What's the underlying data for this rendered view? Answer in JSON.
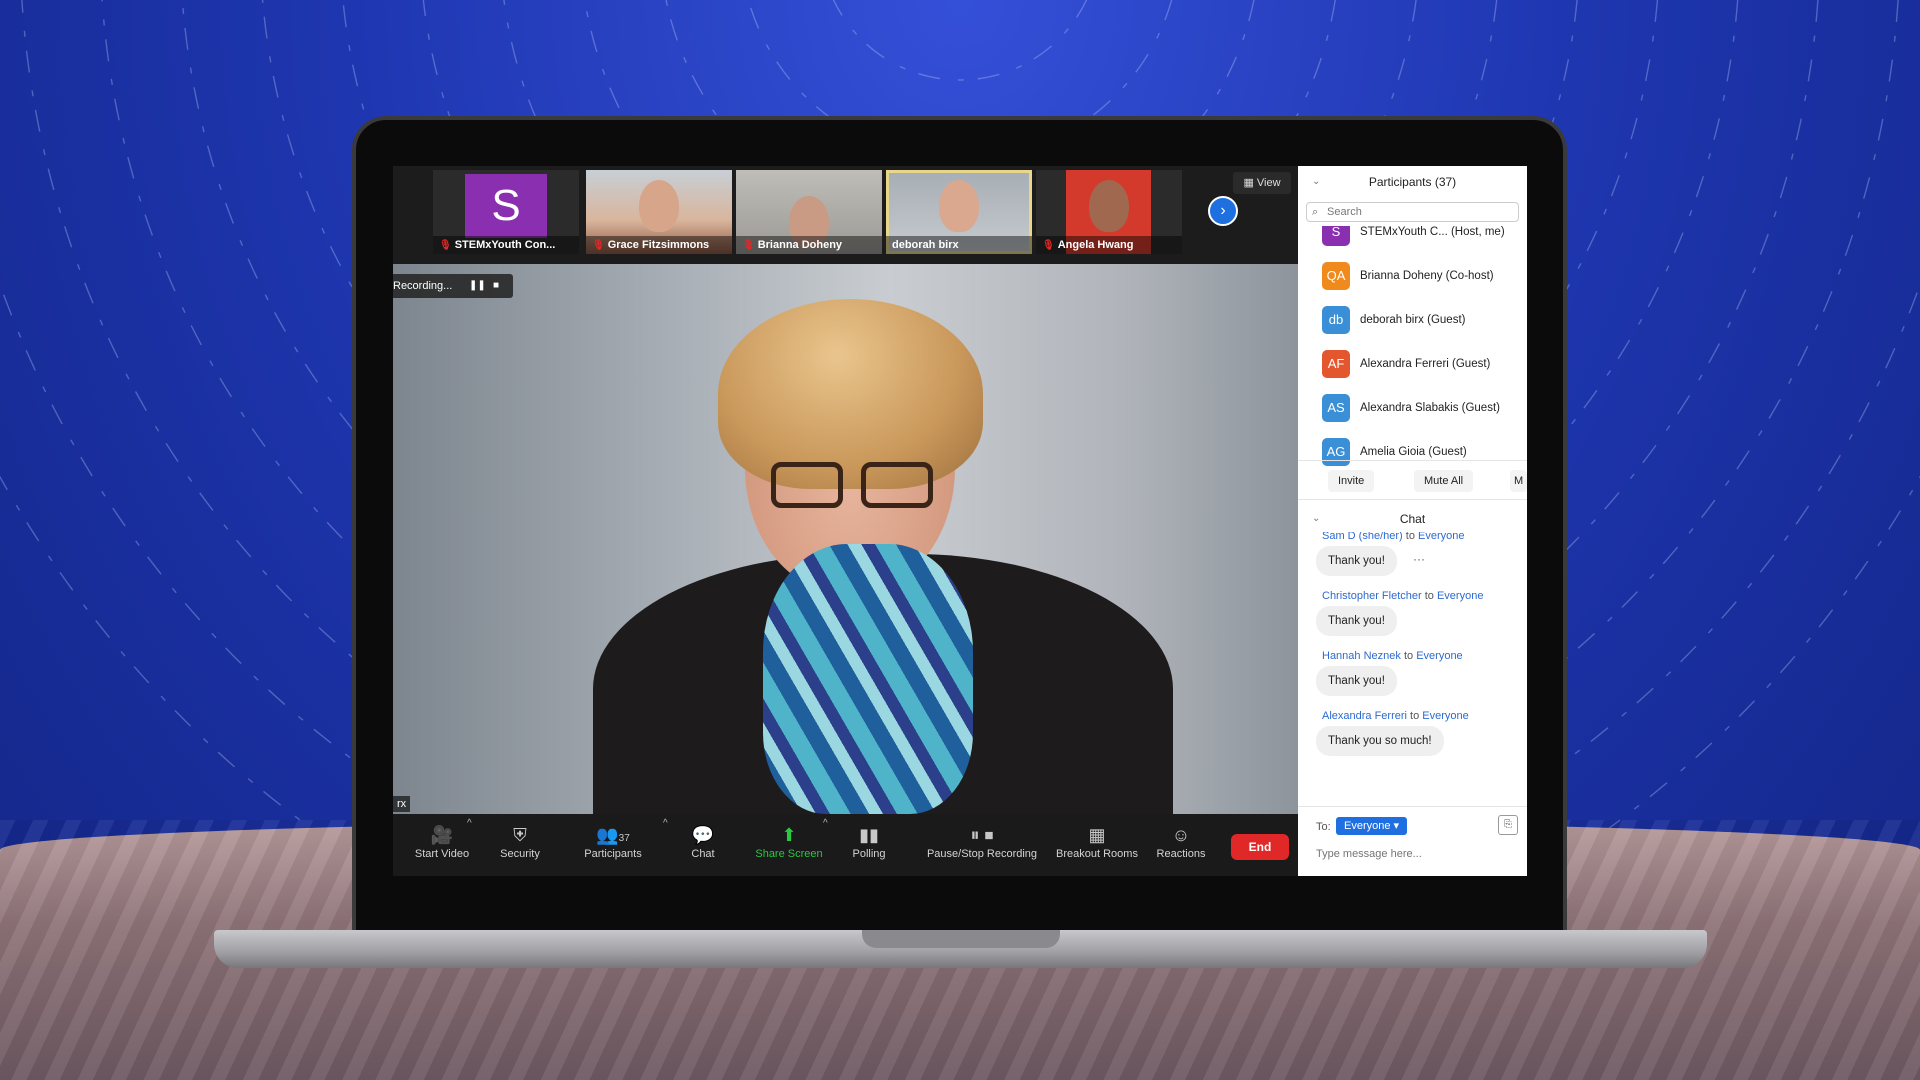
{
  "colors": {
    "accent": "#1f6fe0",
    "end_button": "#e02828",
    "share_screen": "#28c840",
    "chat_name": "#2d6ad0",
    "active_speaker_border": "#e8d78a"
  },
  "gallery": {
    "view_label": "View",
    "tiles": [
      {
        "name": "STEMxYouth Con...",
        "avatar_letter": "S",
        "avatar_color": "#8a2fb0",
        "muted": true
      },
      {
        "name": "Grace Fitzsimmons",
        "muted": true
      },
      {
        "name": "Brianna Doheny",
        "muted": true
      },
      {
        "name": "deborah birx",
        "muted": false,
        "active": true
      },
      {
        "name": "Angela Hwang",
        "muted": true
      }
    ],
    "next_icon": "chevron-right-icon"
  },
  "main_video": {
    "recording_label": "Recording...",
    "pause_icon": "pause-icon",
    "stop_icon": "stop-icon",
    "name_tag": "rx"
  },
  "toolbar": {
    "start_video": "Start Video",
    "security": "Security",
    "participants": "Participants",
    "participants_count": "37",
    "chat": "Chat",
    "share_screen": "Share Screen",
    "polling": "Polling",
    "pause_stop_recording": "Pause/Stop Recording",
    "breakout_rooms": "Breakout Rooms",
    "reactions": "Reactions",
    "end": "End"
  },
  "participants": {
    "title": "Participants (37)",
    "search_placeholder": "Search",
    "partial_row": "STEMxYouth C... (Host, me)",
    "rows": [
      {
        "initials": "QA",
        "name": "Brianna Doheny (Co-host)",
        "color": "#f08a1c"
      },
      {
        "initials": "db",
        "name": "deborah birx (Guest)",
        "color": "#3a8fd6"
      },
      {
        "initials": "AF",
        "name": "Alexandra Ferreri (Guest)",
        "color": "#e4572e"
      },
      {
        "initials": "AS",
        "name": "Alexandra Slabakis (Guest)",
        "color": "#3a8fd6"
      },
      {
        "initials": "AG",
        "name": "Amelia Gioia (Guest)",
        "color": "#3a8fd6"
      }
    ],
    "invite": "Invite",
    "mute_all": "Mute All",
    "more": "M"
  },
  "chat": {
    "title": "Chat",
    "to_word": "to",
    "messages": [
      {
        "sender": "Sam D (she/her)",
        "recipient": "Everyone",
        "text": "Thank you!"
      },
      {
        "sender": "Christopher Fletcher",
        "recipient": "Everyone",
        "text": "Thank you!"
      },
      {
        "sender": "Hannah Neznek",
        "recipient": "Everyone",
        "text": "Thank you!"
      },
      {
        "sender": "Alexandra Ferreri",
        "recipient": "Everyone",
        "text": "Thank you so much!"
      }
    ],
    "more_label": "···",
    "to_label": "To:",
    "to_value": "Everyone",
    "input_placeholder": "Type message here..."
  }
}
